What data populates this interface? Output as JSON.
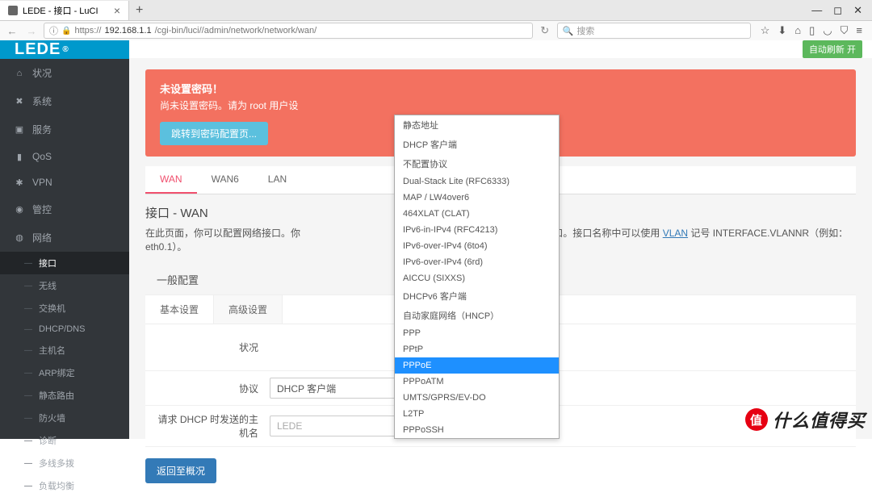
{
  "browser": {
    "tab_title": "LEDE - 接口 - LuCI",
    "url_protocol": "https://",
    "url_host": "192.168.1.1",
    "url_path": "/cgi-bin/luci//admin/network/network/wan/",
    "search_placeholder": "搜索"
  },
  "brand": "LEDE",
  "auto_refresh": "自动刷新 开",
  "sidebar": {
    "status": "状况",
    "system": "系统",
    "services": "服务",
    "qos": "QoS",
    "vpn": "VPN",
    "control": "管控",
    "network": "网络",
    "sub": {
      "interfaces": "接口",
      "wireless": "无线",
      "switch": "交换机",
      "dhcp_dns": "DHCP/DNS",
      "hostnames": "主机名",
      "arp_bind": "ARP绑定",
      "static_routes": "静态路由",
      "firewall": "防火墙",
      "diagnostics": "诊断",
      "mwan": "多线多拨",
      "loadbalance": "负载均衡"
    }
  },
  "alert": {
    "title": "未设置密码！",
    "msg": "尚未设置密码。请为 root 用户设",
    "btn": "跳转到密码配置页..."
  },
  "tabs": {
    "wan": "WAN",
    "wan6": "WAN6",
    "lan": "LAN"
  },
  "page": {
    "title": "接口 - WAN",
    "desc_pre": "在此页面，你可以配置网络接口。你",
    "desc_mid": "口的名称来桥接多个接口。接口名称中可以使用 ",
    "desc_link": "VLAN",
    "desc_post": " 记号 INTERFACE.VLANNR（例如：eth0.1）。"
  },
  "config": {
    "header": "一般配置",
    "basic": "基本设置",
    "advanced": "高级设置",
    "status_label": "状况",
    "protocol_label": "协议",
    "protocol_value": "DHCP 客户端",
    "hostname_label": "请求 DHCP 时发送的主机名",
    "hostname_value": "LEDE"
  },
  "dropdown": {
    "static": "静态地址",
    "dhcp": "DHCP 客户端",
    "unmanaged": "不配置协议",
    "dslite": "Dual-Stack Lite (RFC6333)",
    "map": "MAP / LW4over6",
    "xlat": "464XLAT (CLAT)",
    "6in4": "IPv6-in-IPv4 (RFC4213)",
    "6to4": "IPv6-over-IPv4 (6to4)",
    "6rd": "IPv6-over-IPv4 (6rd)",
    "aiccu": "AICCU (SIXXS)",
    "dhcpv6": "DHCPv6 客户端",
    "hncp": "自动家庭网络（HNCP）",
    "ppp": "PPP",
    "pptp": "PPtP",
    "pppoe": "PPPoE",
    "pppoatm": "PPPoATM",
    "umts": "UMTS/GPRS/EV-DO",
    "l2tp": "L2TP",
    "pppossh": "PPPoSSH"
  },
  "back_btn": "返回至概况",
  "watermark": "什么值得买",
  "watermark_badge": "值"
}
